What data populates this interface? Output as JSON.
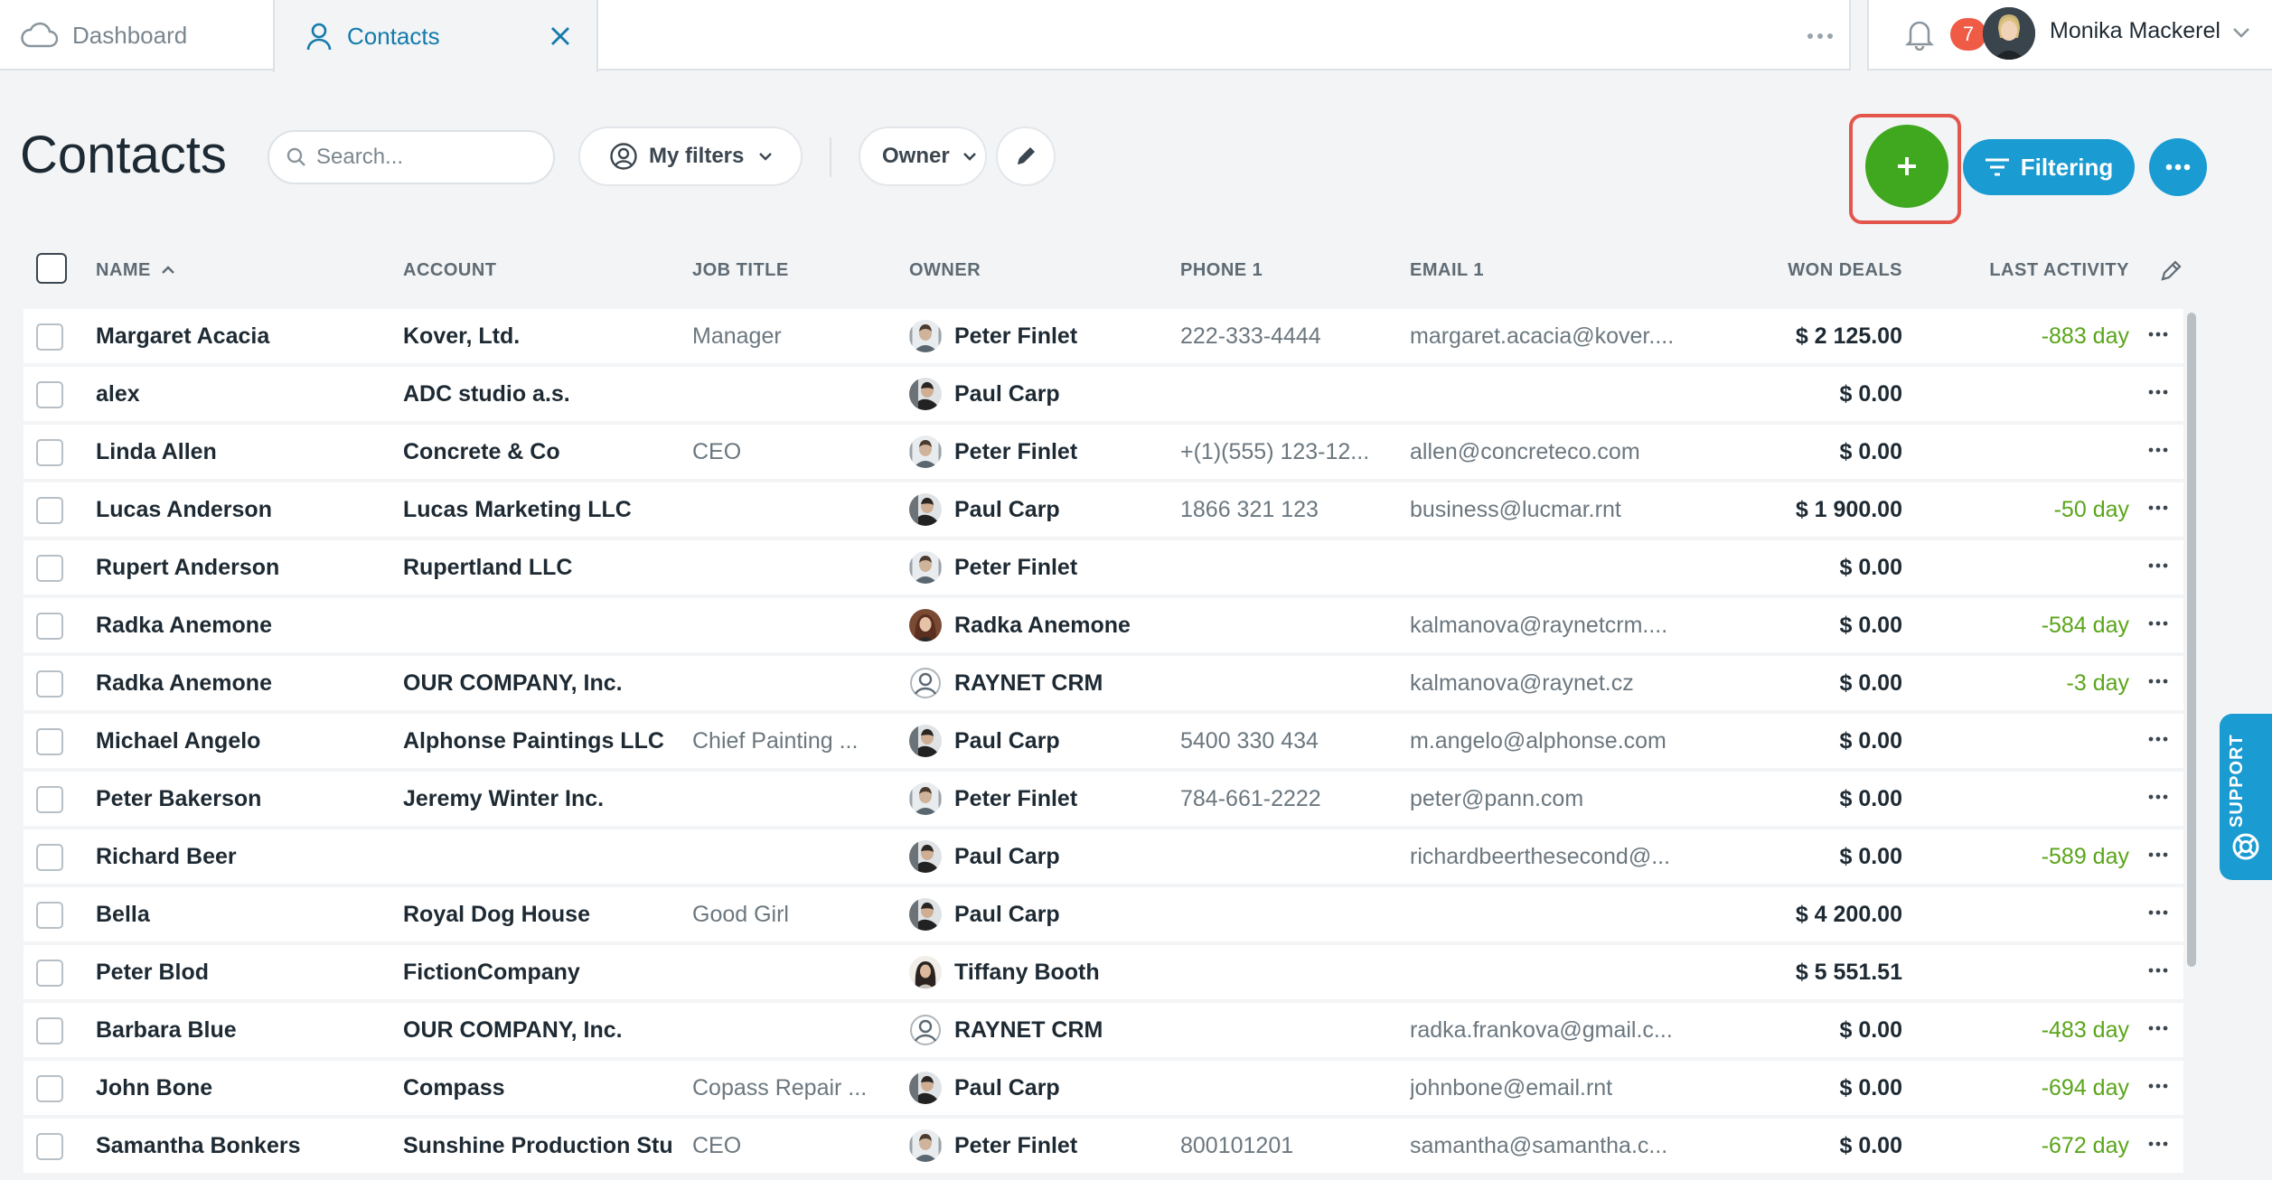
{
  "tabs": [
    {
      "label": "Dashboard",
      "active": false
    },
    {
      "label": "Contacts",
      "active": true
    }
  ],
  "notifications": {
    "count": "7"
  },
  "user": {
    "name": "Monika Mackerel"
  },
  "page": {
    "title": "Contacts"
  },
  "search": {
    "placeholder": "Search..."
  },
  "filters": {
    "my_filters_label": "My filters",
    "owner_label": "Owner"
  },
  "actions": {
    "add_label": "+",
    "filtering_label": "Filtering"
  },
  "support": {
    "label": "SUPPORT"
  },
  "colors": {
    "accent": "#1a9bd1",
    "add": "#3fa81e",
    "highlight": "#e2564c",
    "positive": "#5aa51a",
    "badge": "#ef5b45"
  },
  "columns": {
    "name": "NAME",
    "account": "ACCOUNT",
    "job_title": "JOB TITLE",
    "owner": "OWNER",
    "phone": "PHONE 1",
    "email": "EMAIL 1",
    "won_deals": "WON DEALS",
    "last_activity": "LAST ACTIVITY"
  },
  "rows": [
    {
      "first": "Margaret",
      "last": "Acacia",
      "account": "Kover, Ltd.",
      "job": "Manager",
      "owner": "Peter Finlet",
      "owner_icon": "peter",
      "phone": "222-333-4444",
      "email": "margaret.acacia@kover....",
      "won": "$ 2 125.00",
      "activity": "-883 day"
    },
    {
      "first": "",
      "last": "alex",
      "account": "ADC studio a.s.",
      "job": "",
      "owner": "Paul Carp",
      "owner_icon": "paul",
      "phone": "",
      "email": "",
      "won": "$ 0.00",
      "activity": ""
    },
    {
      "first": "Linda",
      "last": "Allen",
      "account": "Concrete & Co",
      "job": "CEO",
      "owner": "Peter Finlet",
      "owner_icon": "peter",
      "phone": "+(1)(555) 123-12...",
      "email": "allen@concreteco.com",
      "won": "$ 0.00",
      "activity": ""
    },
    {
      "first": "Lucas",
      "last": "Anderson",
      "account": "Lucas Marketing LLC",
      "job": "",
      "owner": "Paul Carp",
      "owner_icon": "paul",
      "phone": "1866 321 123",
      "email": "business@lucmar.rnt",
      "won": "$ 1 900.00",
      "activity": "-50 day"
    },
    {
      "first": "Rupert",
      "last": "Anderson",
      "account": "Rupertland LLC",
      "job": "",
      "owner": "Peter Finlet",
      "owner_icon": "peter",
      "phone": "",
      "email": "",
      "won": "$ 0.00",
      "activity": ""
    },
    {
      "first": "Radka",
      "last": "Anemone",
      "account": "",
      "job": "",
      "owner": "Radka Anemone",
      "owner_icon": "radka",
      "phone": "",
      "email": "kalmanova@raynetcrm....",
      "won": "$ 0.00",
      "activity": "-584 day"
    },
    {
      "first": "Radka",
      "last": "Anemone",
      "account": "OUR COMPANY, Inc.",
      "job": "",
      "owner": "RAYNET CRM",
      "owner_icon": "raynet",
      "phone": "",
      "email": "kalmanova@raynet.cz",
      "won": "$ 0.00",
      "activity": "-3 day"
    },
    {
      "first": "Michael",
      "last": "Angelo",
      "account": "Alphonse Paintings LLC",
      "job": "Chief Painting ...",
      "owner": "Paul Carp",
      "owner_icon": "paul",
      "phone": "5400 330 434",
      "email": "m.angelo@alphonse.com",
      "won": "$ 0.00",
      "activity": ""
    },
    {
      "first": "Peter",
      "last": "Bakerson",
      "account": "Jeremy Winter Inc.",
      "job": "",
      "owner": "Peter Finlet",
      "owner_icon": "peter",
      "phone": "784-661-2222",
      "email": "peter@pann.com",
      "won": "$ 0.00",
      "activity": ""
    },
    {
      "first": "Richard",
      "last": "Beer",
      "account": "",
      "job": "",
      "owner": "Paul Carp",
      "owner_icon": "paul",
      "phone": "",
      "email": "richardbeerthesecond@...",
      "won": "$ 0.00",
      "activity": "-589 day"
    },
    {
      "first": "",
      "last": "Bella",
      "account": "Royal Dog House",
      "job": "Good Girl",
      "owner": "Paul Carp",
      "owner_icon": "paul",
      "phone": "",
      "email": "",
      "won": "$ 4 200.00",
      "activity": ""
    },
    {
      "first": "Peter",
      "last": "Blod",
      "account": "FictionCompany",
      "job": "",
      "owner": "Tiffany Booth",
      "owner_icon": "tiffany",
      "phone": "",
      "email": "",
      "won": "$ 5 551.51",
      "activity": ""
    },
    {
      "first": "Barbara",
      "last": "Blue",
      "account": "OUR COMPANY, Inc.",
      "job": "",
      "owner": "RAYNET CRM",
      "owner_icon": "raynet",
      "phone": "",
      "email": "radka.frankova@gmail.c...",
      "won": "$ 0.00",
      "activity": "-483 day"
    },
    {
      "first": "John",
      "last": "Bone",
      "account": "Compass",
      "job": "Copass Repair ...",
      "owner": "Paul Carp",
      "owner_icon": "paul",
      "phone": "",
      "email": "johnbone@email.rnt",
      "won": "$ 0.00",
      "activity": "-694 day"
    },
    {
      "first": "Samantha",
      "last": "Bonkers",
      "account": "Sunshine Production Stu",
      "job": "CEO",
      "owner": "Peter Finlet",
      "owner_icon": "peter",
      "phone": "800101201",
      "email": "samantha@samantha.c...",
      "won": "$ 0.00",
      "activity": "-672 day"
    }
  ]
}
